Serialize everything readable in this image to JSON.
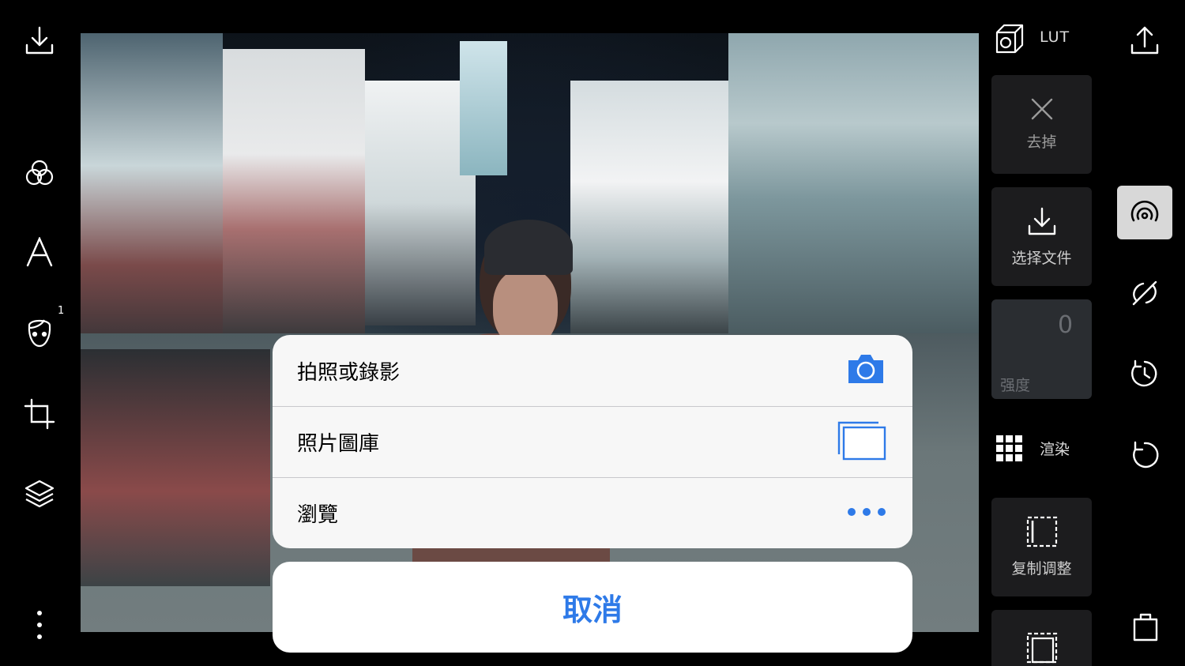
{
  "left_toolbar": {
    "items": [
      {
        "name": "download-icon"
      },
      {
        "name": "filters-icon"
      },
      {
        "name": "text-icon"
      },
      {
        "name": "face-icon",
        "badge": "1"
      },
      {
        "name": "crop-icon"
      },
      {
        "name": "layers-icon"
      },
      {
        "name": "more-vertical-icon"
      }
    ]
  },
  "right_panel": {
    "lut_label": "LUT",
    "remove_label": "去掉",
    "select_file_label": "选择文件",
    "strength_label": "强度",
    "strength_value_text": "0",
    "render_label": "渲染",
    "copy_adjust_label": "复制调整"
  },
  "right_toolbar": {
    "items": [
      {
        "name": "share-upload-icon"
      },
      {
        "name": "lut-tool-icon",
        "active": true
      },
      {
        "name": "heal-icon"
      },
      {
        "name": "history-icon"
      },
      {
        "name": "undo-icon"
      },
      {
        "name": "bag-icon"
      }
    ]
  },
  "action_sheet": {
    "options": [
      {
        "label": "拍照或錄影",
        "icon": "camera-icon"
      },
      {
        "label": "照片圖庫",
        "icon": "photo-library-icon"
      },
      {
        "label": "瀏覽",
        "icon": "ellipsis-icon"
      }
    ],
    "cancel_label": "取消"
  },
  "colors": {
    "accent_blue": "#2e7ae8",
    "sheet_bg": "#f7f7f7",
    "panel_card": "#1c1c1e"
  }
}
